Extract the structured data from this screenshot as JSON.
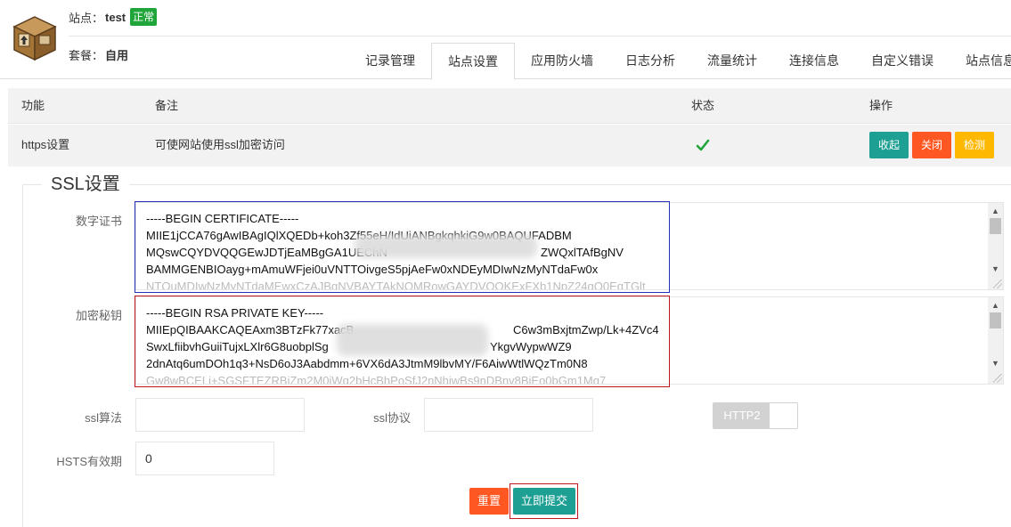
{
  "header": {
    "site_label": "站点：",
    "site_name": "test",
    "site_status": "正常",
    "plan_label": "套餐：",
    "plan_name": "自用",
    "colors": {
      "status_green": "#20a53a"
    }
  },
  "tabs": [
    {
      "label": "记录管理"
    },
    {
      "label": "站点设置",
      "active": true
    },
    {
      "label": "应用防火墙"
    },
    {
      "label": "日志分析"
    },
    {
      "label": "流量统计"
    },
    {
      "label": "连接信息"
    },
    {
      "label": "自定义错误"
    },
    {
      "label": "站点信息"
    }
  ],
  "feature_table": {
    "headers": {
      "feature": "功能",
      "note": "备注",
      "status": "状态",
      "action": "操作"
    },
    "rows": [
      {
        "feature": "https设置",
        "note": "可使网站使用ssl加密访问",
        "status_icon": "check-icon",
        "actions": {
          "collapse": "收起",
          "close": "关闭",
          "check": "检测"
        }
      }
    ]
  },
  "ssl": {
    "legend": "SSL设置",
    "cert_label": "数字证书",
    "cert_lines": [
      "-----BEGIN CERTIFICATE-----",
      "MIIE1jCCA76gAwIBAgIQlXQEDb+koh3Zf55eH/IdUiANBgkqhkiG9w0BAQUFADBM",
      "MQswCQYDVQQGEwJDTjEaMBgGA1UEChN",
      "BAMMGENBIOayg+mAmuWFjei0uVNTTOivgeS5pjAeFw0xNDEyMDIwNzMyNTdaFw0x"
    ],
    "cert_line3_tail": "ZWQxlTAfBgNV",
    "key_label": "加密秘钥",
    "key_lines": [
      "-----BEGIN RSA PRIVATE KEY-----",
      "MIIEpQIBAAKCAQEAxm3BTzFk77xacB",
      "SwxLfiibvhGuiiTujxLXlr6G8uobplSg",
      "2dnAtq6umDOh1q3+NsD6oJ3Aabdmm+6VX6dA3JtmM9lbvMY/F6AiwWtlWQzTm0N8"
    ],
    "key_line2_tail": "C6w3mBxjtmZwp/Lk+4ZVc4",
    "key_line3_tail": "YkgvWypwWZ9",
    "algo_label": "ssl算法",
    "algo_value": "",
    "proto_label": "ssl协议",
    "proto_value": "",
    "http2_label": "HTTP2",
    "hsts_label": "HSTS有效期",
    "hsts_value": "0",
    "reset_label": "重置",
    "submit_label": "立即提交"
  }
}
